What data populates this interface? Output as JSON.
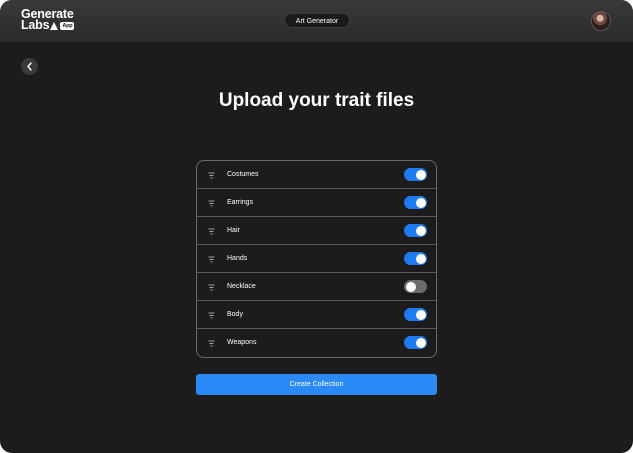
{
  "header": {
    "logo": {
      "line1": "Generate",
      "line2": "Labs",
      "badge": "App"
    },
    "nav_pill": "Art Generator",
    "avatar_icon": "user-avatar"
  },
  "back_button": {
    "icon": "chevron-left-icon"
  },
  "main": {
    "title": "Upload your trait files",
    "traits": [
      {
        "label": "Costumes",
        "enabled": true
      },
      {
        "label": "Earrings",
        "enabled": true
      },
      {
        "label": "Hair",
        "enabled": true
      },
      {
        "label": "Hands",
        "enabled": true
      },
      {
        "label": "Necklace",
        "enabled": false
      },
      {
        "label": "Body",
        "enabled": true
      },
      {
        "label": "Weapons",
        "enabled": true
      }
    ],
    "cta_label": "Create Collection"
  },
  "colors": {
    "accent": "#2b8af7",
    "background": "#1c1c1c",
    "toggle_off": "#6b6b6b"
  }
}
